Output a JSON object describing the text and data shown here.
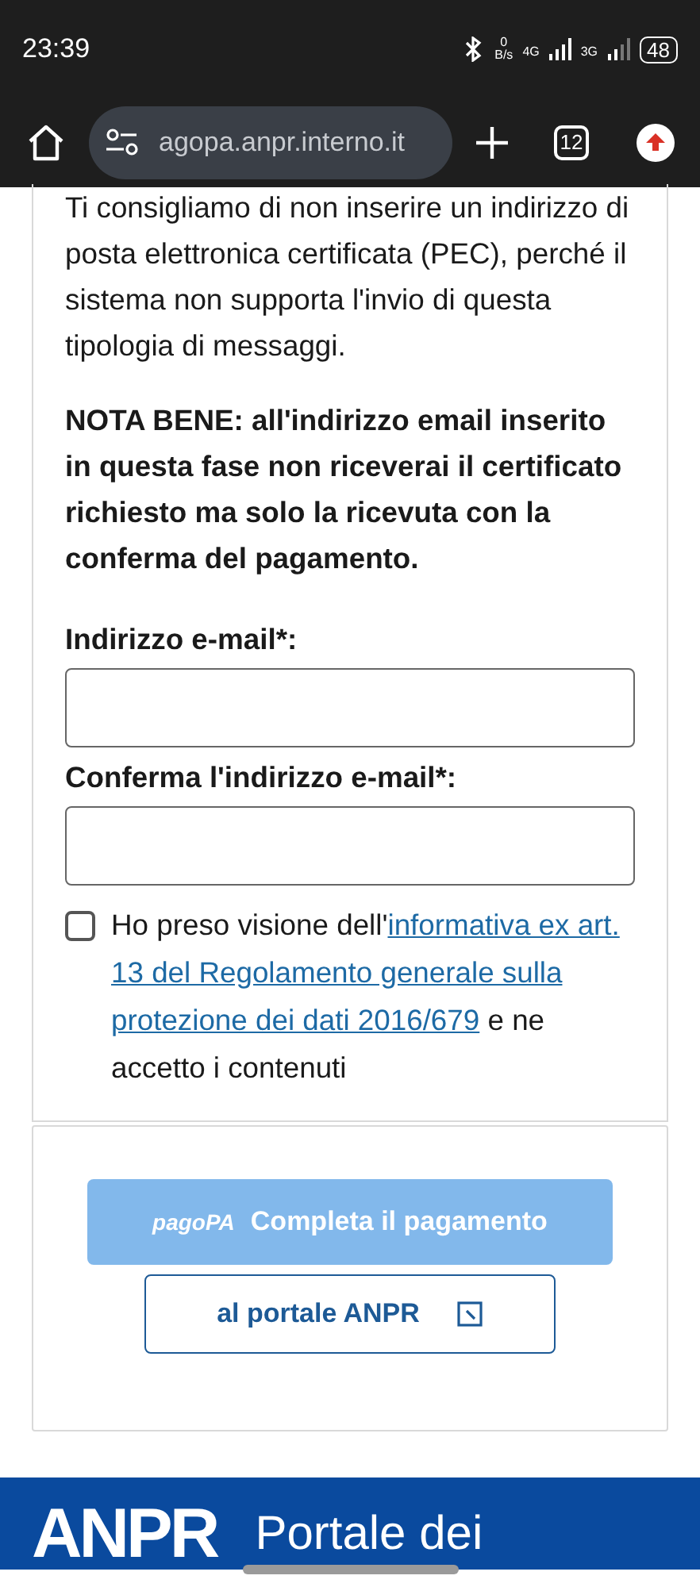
{
  "status_bar": {
    "time": "23:39",
    "net_speed_value": "0",
    "net_speed_unit": "B/s",
    "net_1": "4G",
    "net_2": "3G",
    "battery": "48"
  },
  "browser": {
    "url": "agopa.anpr.interno.it",
    "tab_count": "12"
  },
  "form": {
    "pec_note": "Ti consigliamo di non inserire un indirizzo di posta elettronica certificata (PEC), perché il sistema non supporta l'invio di questa tipologia di messaggi.",
    "notice": "NOTA BENE: all'indirizzo email inserito in questa fase non riceverai il certificato richiesto ma solo la ricevuta con la conferma del pagamento.",
    "fields": [
      {
        "label": "Indirizzo e-mail*:"
      },
      {
        "label": "Conferma l'indirizzo e-mail*:"
      }
    ],
    "consent": {
      "checked": false,
      "before": "Ho preso visione dell'",
      "link_lines": [
        "informativa ex art.",
        "13 del Regolamento generale sulla",
        "protezione dei dati 2016/679"
      ],
      "after": " e ne accetto i contenuti"
    }
  },
  "actions": {
    "pay_logo": "pagoPA",
    "pay_button": "Completa il pagamento",
    "pay_disabled": true,
    "back_button": "al portale ANPR"
  },
  "footer": {
    "logo": "ANPR",
    "title": "Portale dei"
  }
}
